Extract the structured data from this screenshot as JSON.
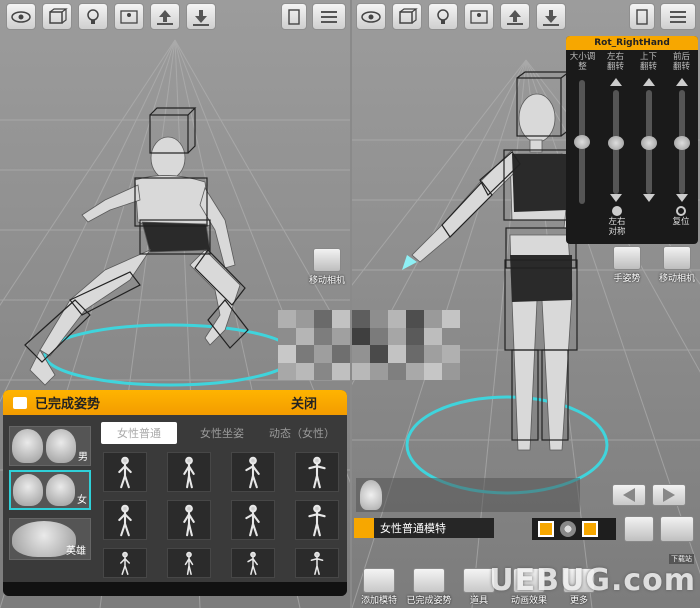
{
  "left_panel": {
    "toolbar": [
      "eye-icon",
      "box-icon",
      "light-bulb-icon",
      "person-box-icon",
      "upload-icon",
      "download-icon",
      "page-icon",
      "list-menu-icon"
    ],
    "move_camera_label": "移动相机",
    "pose_dialog": {
      "title": "已完成姿势",
      "close_label": "关闭",
      "genders": [
        {
          "label": "男",
          "selected": false
        },
        {
          "label": "女",
          "selected": true
        },
        {
          "label": "英雄",
          "selected": false
        }
      ],
      "tabs": [
        {
          "label": "女性普通",
          "active": true
        },
        {
          "label": "女性坐姿",
          "active": false
        },
        {
          "label": "动态（女性）",
          "active": false
        }
      ]
    }
  },
  "right_panel": {
    "toolbar": [
      "eye-icon",
      "box-icon",
      "light-bulb-icon",
      "person-box-icon",
      "upload-icon",
      "download-icon",
      "page-icon",
      "list-menu-icon"
    ],
    "rot_panel": {
      "title": "Rot_RightHand",
      "columns": [
        {
          "l1": "大小调",
          "l2": "整"
        },
        {
          "l1": "左右",
          "l2": "翻转"
        },
        {
          "l1": "上下",
          "l2": "翻转"
        },
        {
          "l1": "前后",
          "l2": "翻转"
        }
      ],
      "flip_label_1": "左右",
      "flip_label_2": "对称",
      "reset_label": "复位"
    },
    "hand_pose_label": "手姿势",
    "move_camera_label": "移动相机",
    "model_label": "女性普通模特",
    "bottom_buttons": [
      "添加模特",
      "已完成姿势",
      "道具",
      "动画效果",
      "更多"
    ]
  },
  "watermark": "UEBUG.com",
  "watermark_small": "下载站"
}
